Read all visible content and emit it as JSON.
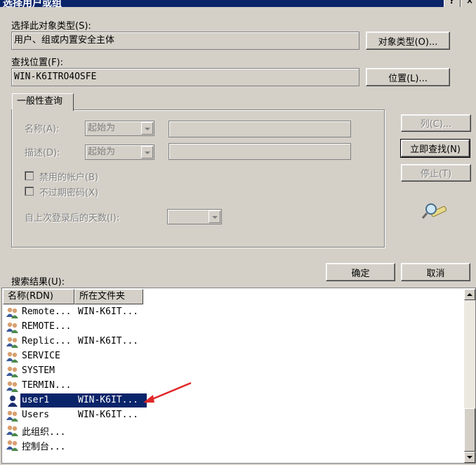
{
  "window": {
    "title": "选择用户或组"
  },
  "object_type": {
    "label": "选择此对象类型(S):",
    "value": "用户、组或内置安全主体",
    "button": "对象类型(O)..."
  },
  "location": {
    "label": "查找位置(F):",
    "value": "WIN-K6ITRO4OSFE",
    "button": "位置(L)..."
  },
  "query": {
    "tab_label": "一般性查询",
    "name_label": "名称(A):",
    "name_op": "起始为",
    "desc_label": "描述(D):",
    "desc_op": "起始为",
    "disabled_accounts": "禁用的帐户(B)",
    "non_expiring": "不过期密码(X)",
    "days_label": "自上次登录后的天数(I):"
  },
  "side_buttons": {
    "columns": "列(C)...",
    "find_now": "立即查找(N)",
    "stop": "停止(T)"
  },
  "ok": "确定",
  "cancel": "取消",
  "results": {
    "label": "搜索结果(U):",
    "columns": [
      "名称(RDN)",
      "所在文件夹"
    ],
    "rows": [
      {
        "name": "Remote...",
        "folder": "WIN-K6IT...",
        "icon": "group-icon"
      },
      {
        "name": "REMOTE...",
        "folder": "",
        "icon": "group-icon"
      },
      {
        "name": "Replic...",
        "folder": "WIN-K6IT...",
        "icon": "group-icon"
      },
      {
        "name": "SERVICE",
        "folder": "",
        "icon": "group-icon"
      },
      {
        "name": "SYSTEM",
        "folder": "",
        "icon": "group-icon"
      },
      {
        "name": "TERMIN...",
        "folder": "",
        "icon": "group-icon"
      },
      {
        "name": "user1",
        "folder": "WIN-K6IT...",
        "icon": "user-icon",
        "selected": true
      },
      {
        "name": "Users",
        "folder": "WIN-K6IT...",
        "icon": "group-icon"
      },
      {
        "name": "此组织...",
        "folder": "",
        "icon": "group-icon"
      },
      {
        "name": "控制台...",
        "folder": "",
        "icon": "group-icon"
      }
    ]
  },
  "colors": {
    "selection": "#0a246a",
    "annotation_arrow": "#e0272a"
  }
}
